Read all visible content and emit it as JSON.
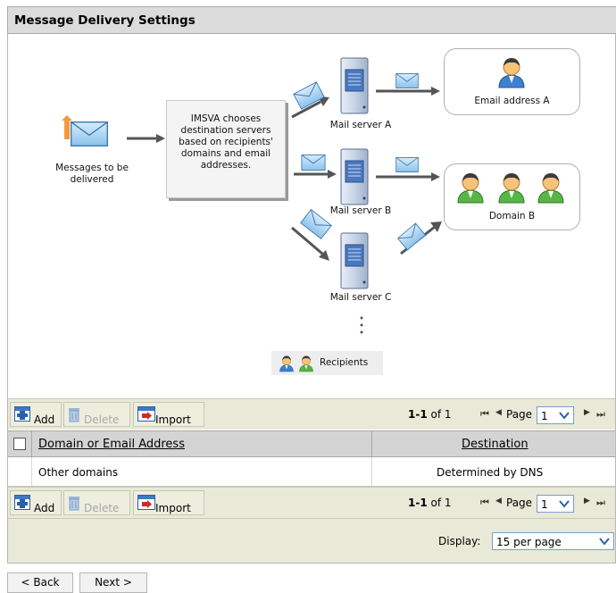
{
  "title": "Message Delivery Settings",
  "diagram": {
    "source_label_1": "Messages to be",
    "source_label_2": "delivered",
    "process_text_1": "IMSVA chooses",
    "process_text_2": "destination servers",
    "process_text_3": "based on recipients'",
    "process_text_4": "domains and email",
    "process_text_5": "addresses.",
    "server_a": "Mail server A",
    "server_b": "Mail server B",
    "server_c": "Mail server C",
    "dest_a": "Email address A",
    "dest_b": "Domain B",
    "legend": "Recipients"
  },
  "toolbar": {
    "add": "Add",
    "delete": "Delete",
    "import": "Import",
    "range": "1-1",
    "of_text": "of 1",
    "page_label": "Page",
    "page_value": "1"
  },
  "table": {
    "col_domain": "Domain or Email Address",
    "col_destination": "Destination",
    "rows": [
      {
        "domain": "Other domains",
        "destination": "Determined by DNS"
      }
    ]
  },
  "display": {
    "label": "Display:",
    "value": "15 per page"
  },
  "nav": {
    "back": "< Back",
    "next": "Next >"
  },
  "colors": {
    "toolbar_bg": "#e9e9d8",
    "header_bg": "#d4d4d4",
    "title_bg": "#dcdcdc"
  }
}
